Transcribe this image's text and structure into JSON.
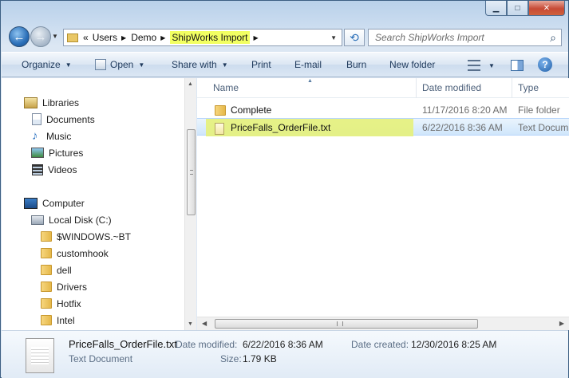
{
  "window": {
    "controls": {
      "minimize": "▁",
      "maximize": "□",
      "close": "✕"
    }
  },
  "address": {
    "chevrons": "«",
    "crumbs": [
      "Users",
      "Demo",
      "ShipWorks Import"
    ],
    "highlight_crumb_index": 2
  },
  "search": {
    "placeholder": "Search ShipWorks Import"
  },
  "toolbar": {
    "organize": "Organize",
    "open": "Open",
    "share_with": "Share with",
    "print": "Print",
    "email": "E-mail",
    "burn": "Burn",
    "new_folder": "New folder",
    "help": "?"
  },
  "navpane": {
    "items": [
      {
        "label": "Libraries",
        "icon": "libraries-icon"
      },
      {
        "label": "Documents",
        "icon": "documents-icon"
      },
      {
        "label": "Music",
        "icon": "music-icon"
      },
      {
        "label": "Pictures",
        "icon": "pictures-icon"
      },
      {
        "label": "Videos",
        "icon": "videos-icon"
      },
      {
        "label": "Computer",
        "icon": "computer-icon"
      },
      {
        "label": "Local Disk (C:)",
        "icon": "disk-icon"
      },
      {
        "label": "$WINDOWS.~BT",
        "icon": "folder-icon"
      },
      {
        "label": "customhook",
        "icon": "folder-icon"
      },
      {
        "label": "dell",
        "icon": "folder-icon"
      },
      {
        "label": "Drivers",
        "icon": "folder-icon"
      },
      {
        "label": "Hotfix",
        "icon": "folder-icon"
      },
      {
        "label": "Intel",
        "icon": "folder-icon"
      }
    ]
  },
  "filepane": {
    "columns": {
      "name": "Name",
      "date": "Date modified",
      "type": "Type"
    },
    "rows": [
      {
        "name": "Complete",
        "date": "11/17/2016 8:20 AM",
        "type": "File folder",
        "icon": "folder-icon"
      },
      {
        "name": "PriceFalls_OrderFile.txt",
        "date": "6/22/2016 8:36 AM",
        "type": "Text Docum",
        "icon": "text-file-icon",
        "selected": true
      }
    ]
  },
  "details": {
    "filename": "PriceFalls_OrderFile.txt",
    "filetype": "Text Document",
    "date_modified_label": "Date modified:",
    "date_modified": "6/22/2016 8:36 AM",
    "date_created_label": "Date created:",
    "date_created": "12/30/2016 8:25 AM",
    "size_label": "Size:",
    "size": "1.79 KB"
  },
  "colors": {
    "selection_highlight": "#e6f17a",
    "address_highlight": "#f2ff62",
    "toolbar_text": "#1e395b"
  }
}
